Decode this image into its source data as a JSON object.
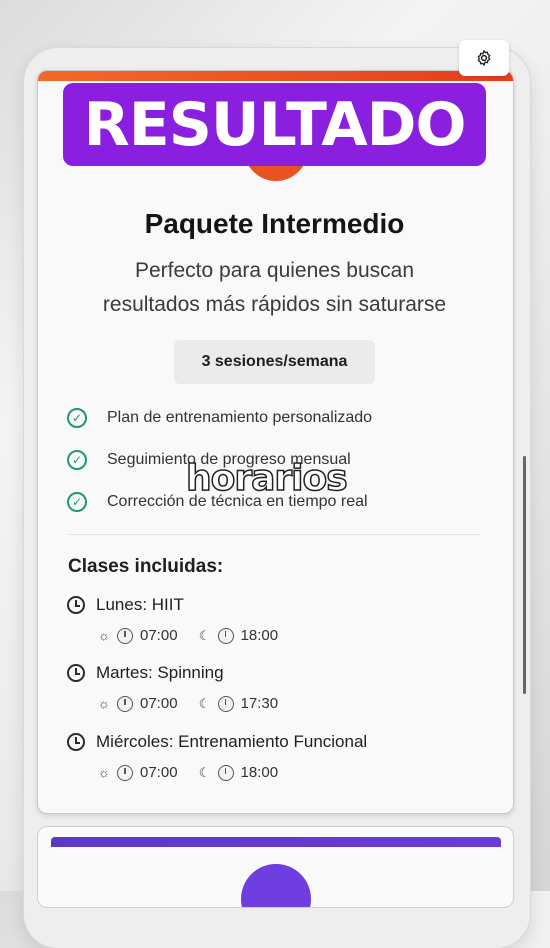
{
  "banner": {
    "text": "RESULTADO"
  },
  "package": {
    "title": "Paquete Intermedio",
    "subtitle_line1": "Perfecto para quienes buscan",
    "subtitle_line2": "resultados más rápidos sin saturarse",
    "sessions": "3 sesiones/semana"
  },
  "features": [
    "Plan de entrenamiento personalizado",
    "Seguimiento de progreso mensual",
    "Corrección de técnica en tiempo real"
  ],
  "classes": {
    "heading": "Clases incluidas:",
    "items": [
      {
        "name": "Lunes: HIIT",
        "morning": "07:00",
        "evening": "18:00"
      },
      {
        "name": "Martes: Spinning",
        "morning": "07:00",
        "evening": "17:30"
      },
      {
        "name": "Miércoles: Entrenamiento Funcional",
        "morning": "07:00",
        "evening": "18:00"
      }
    ]
  },
  "overlay": {
    "caption": "horarios"
  },
  "icons": {
    "settings": "gear-icon",
    "check": "check-circle-icon",
    "clock": "clock-icon",
    "morning": "sun-icon",
    "evening": "moon-icon"
  },
  "colors": {
    "banner": "#8a1fe0",
    "accent_orange": "#e9531f",
    "check_green": "#1f9b6a",
    "next_card_purple": "#6f3ee0"
  }
}
